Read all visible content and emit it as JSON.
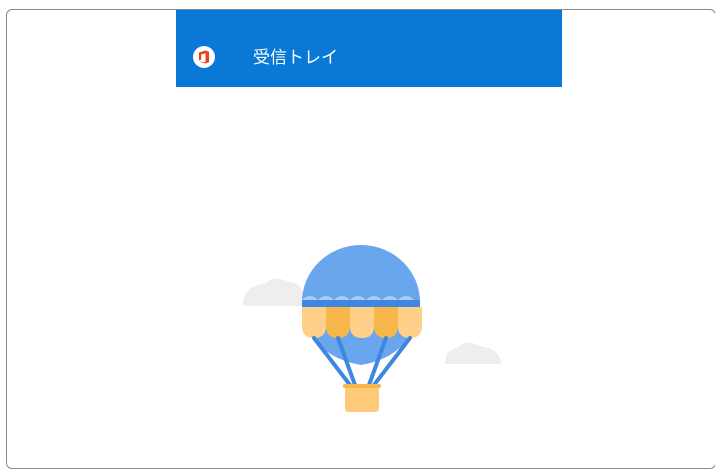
{
  "header": {
    "title": "受信トレイ",
    "app_icon": "office-icon",
    "background": "#0a78d7"
  },
  "empty_state": {
    "illustration": "hot-air-balloon-icon",
    "balloon_colors": {
      "top": "#6aa6ee",
      "band": "#3f86e0",
      "scallop_light": "#ffd088",
      "scallop_dark": "#f6b64a",
      "basket": "#ffc97a"
    },
    "cloud_color": "#eeeeee"
  }
}
